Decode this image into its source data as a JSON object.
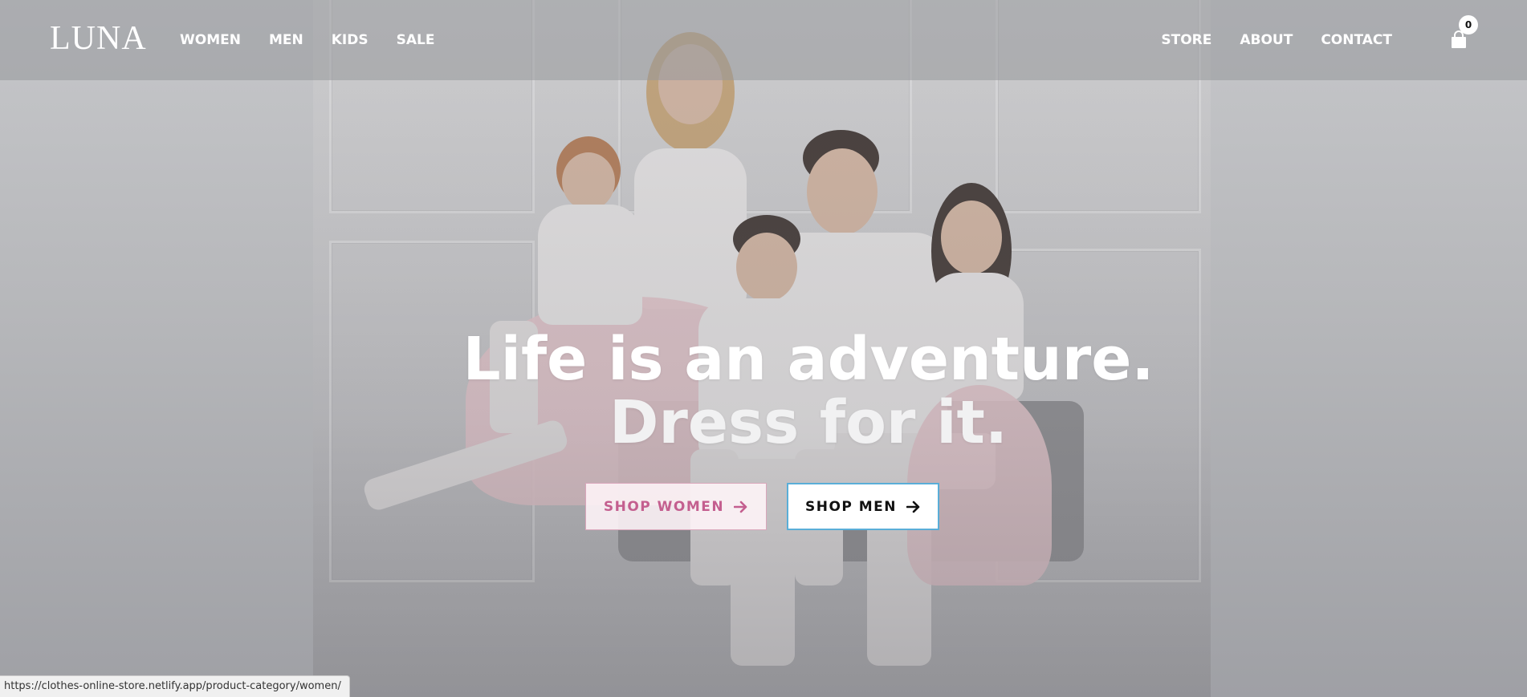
{
  "brand": {
    "logo_text": "LUNA"
  },
  "nav": {
    "left": [
      "WOMEN",
      "MEN",
      "KIDS",
      "SALE"
    ],
    "right": [
      "STORE",
      "ABOUT",
      "CONTACT"
    ]
  },
  "cart": {
    "icon": "shopping-bag-icon",
    "count": "0"
  },
  "hero": {
    "headline_line1": "Life is an adventure.",
    "headline_line2": "Dress for it.",
    "buttons": {
      "shop_women": "SHOP WOMEN",
      "shop_men": "SHOP MEN"
    },
    "arrow_icon": "arrow-right-icon"
  },
  "status_bar": {
    "url": "https://clothes-online-store.netlify.app/product-category/women/"
  },
  "colors": {
    "women_accent": "#c45f8f",
    "men_border": "#5aaed8",
    "header_overlay": "#96979b"
  }
}
